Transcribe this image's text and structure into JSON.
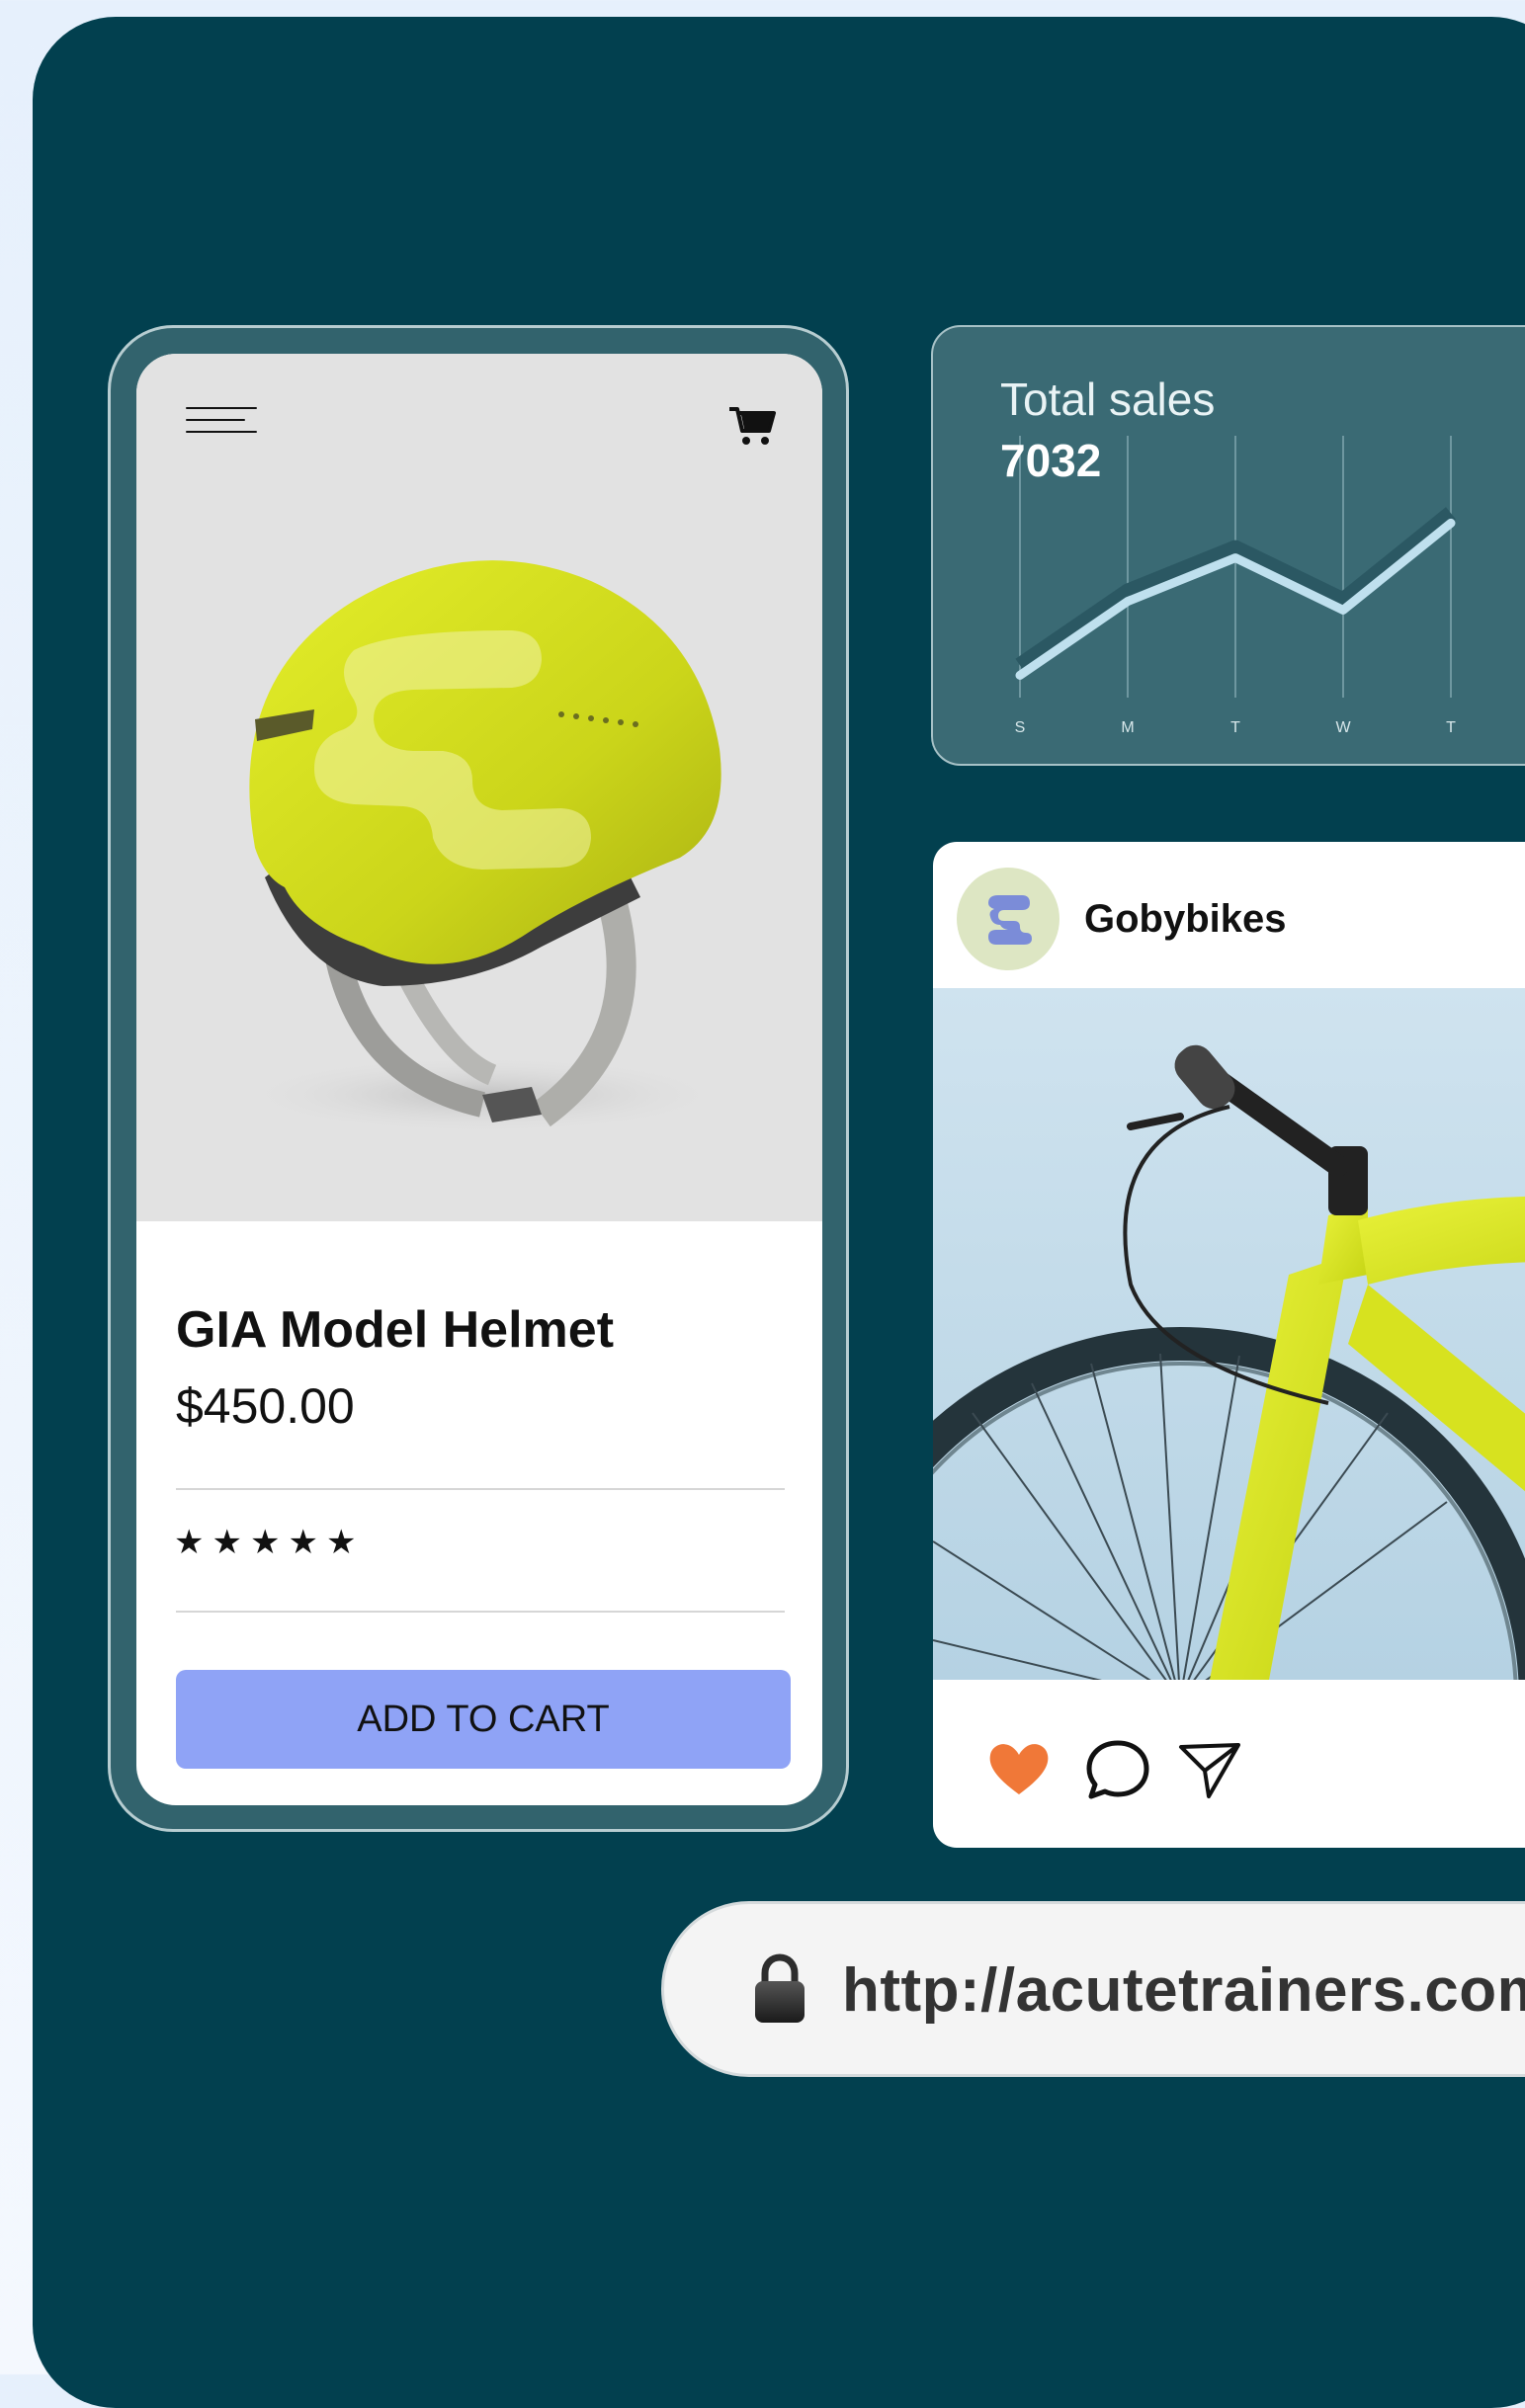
{
  "product": {
    "title": "GIA Model Helmet",
    "price": "$450.00",
    "rating": 5,
    "stars": [
      "★",
      "★",
      "★",
      "★",
      "★"
    ],
    "add_to_cart_label": "ADD TO CART",
    "helmet_color": "#d8e31a",
    "button_color": "#8fa3f6"
  },
  "sales": {
    "label": "Total sales",
    "value": "7032"
  },
  "chart_data": {
    "type": "line",
    "title": "Total sales",
    "categories": [
      "S",
      "M",
      "T",
      "W",
      "T"
    ],
    "series": [
      {
        "values": [
          8,
          42,
          62,
          38,
          78
        ]
      }
    ],
    "ylim": [
      0,
      100
    ],
    "grid": true
  },
  "post": {
    "account_name": "Gobybikes",
    "image_subject": "yellow bicycle",
    "like_color": "#f07838",
    "actions": [
      "heart-icon",
      "comment-icon",
      "send-icon"
    ]
  },
  "browser": {
    "url": "http://acutetrainers.com"
  },
  "colors": {
    "background": "#02404f",
    "card": "#3a6a74",
    "accent": "#8fa3f6"
  }
}
